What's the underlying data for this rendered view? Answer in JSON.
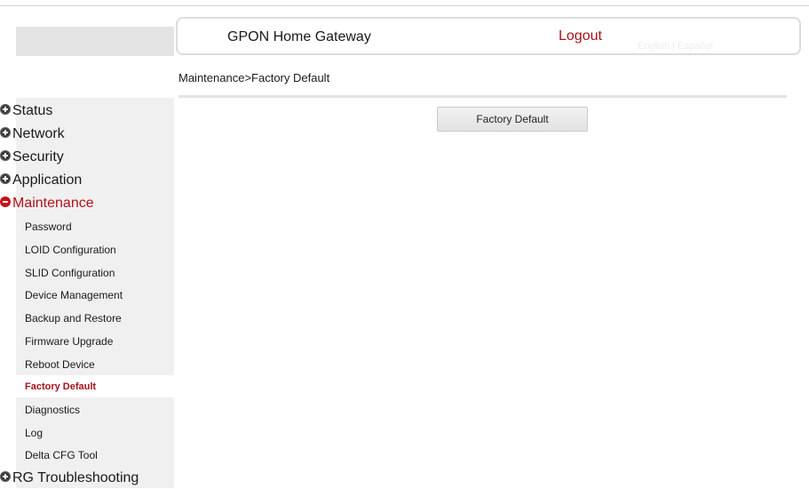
{
  "header": {
    "title": "GPON Home Gateway",
    "logout_label": "Logout",
    "lang_english": "English",
    "lang_separator": "|",
    "lang_spanish": "Español"
  },
  "breadcrumb": "Maintenance>Factory Default",
  "main": {
    "factory_default_button": "Factory Default"
  },
  "sidebar": {
    "sections": [
      {
        "label": "Status",
        "state": "collapsed"
      },
      {
        "label": "Network",
        "state": "collapsed"
      },
      {
        "label": "Security",
        "state": "collapsed"
      },
      {
        "label": "Application",
        "state": "collapsed"
      },
      {
        "label": "Maintenance",
        "state": "expanded"
      },
      {
        "label": "RG Troubleshooting",
        "state": "collapsed"
      }
    ],
    "maintenance_items": [
      {
        "label": "Password"
      },
      {
        "label": "LOID Configuration"
      },
      {
        "label": "SLID Configuration"
      },
      {
        "label": "Device Management"
      },
      {
        "label": "Backup and Restore"
      },
      {
        "label": "Firmware Upgrade"
      },
      {
        "label": "Reboot Device"
      },
      {
        "label": "Factory Default",
        "active": true
      },
      {
        "label": "Diagnostics"
      },
      {
        "label": "Log"
      },
      {
        "label": "Delta CFG Tool"
      }
    ]
  },
  "colors": {
    "accent_red": "#a8101a",
    "sidebar_bg": "#f0f0f0",
    "active_item_bg": "#ffffff"
  },
  "icons": {
    "collapsed": "plus-circle-icon",
    "expanded": "minus-circle-icon"
  }
}
